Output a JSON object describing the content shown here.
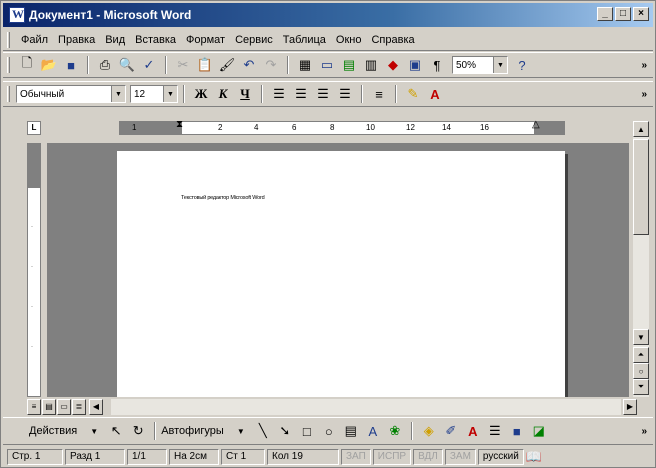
{
  "window": {
    "title": "Документ1 - Microsoft Word",
    "minimize_glyph": "_",
    "maximize_glyph": "□",
    "close_glyph": "×"
  },
  "menu": {
    "items": [
      "Файл",
      "Правка",
      "Вид",
      "Вставка",
      "Формат",
      "Сервис",
      "Таблица",
      "Окно",
      "Справка"
    ]
  },
  "standard_toolbar": {
    "icons": [
      "new-document-icon",
      "open-folder-icon",
      "save-icon",
      "print-icon",
      "print-preview-icon",
      "spelling-icon",
      "cut-icon",
      "paste-icon",
      "format-painter-icon",
      "undo-icon",
      "redo-icon",
      "tables-borders-icon",
      "insert-table-icon",
      "insert-excel-icon",
      "columns-icon",
      "drawing-icon",
      "document-map-icon",
      "show-hide-paragraph-icon",
      "help-icon"
    ],
    "zoom_value": "50%"
  },
  "formatting_toolbar": {
    "style_value": "Обычный",
    "font_size_value": "12",
    "bold_label": "Ж",
    "italic_label": "К",
    "underline_label": "Ч"
  },
  "ruler": {
    "ticks": [
      "1",
      "2",
      "4",
      "6",
      "8",
      "10",
      "12",
      "14",
      "16"
    ]
  },
  "document": {
    "text": "Текстовый редактор Microsoft Word"
  },
  "drawing_toolbar": {
    "actions_label": "Действия",
    "autoshapes_label": "Автофигуры"
  },
  "status_bar": {
    "page": "Стр. 1",
    "section": "Разд 1",
    "page_of": "1/1",
    "at": "На 2см",
    "line": "Ст 1",
    "column": "Кол 19",
    "rec": "ЗАП",
    "trk": "ИСПР",
    "ext": "ВДЛ",
    "ovr": "ЗАМ",
    "language": "русский"
  },
  "colors": {
    "title_gradient_start": "#0a246a",
    "title_gradient_end": "#a6caf0",
    "workspace_gray": "#808080",
    "chrome": "#d4d0c8"
  }
}
